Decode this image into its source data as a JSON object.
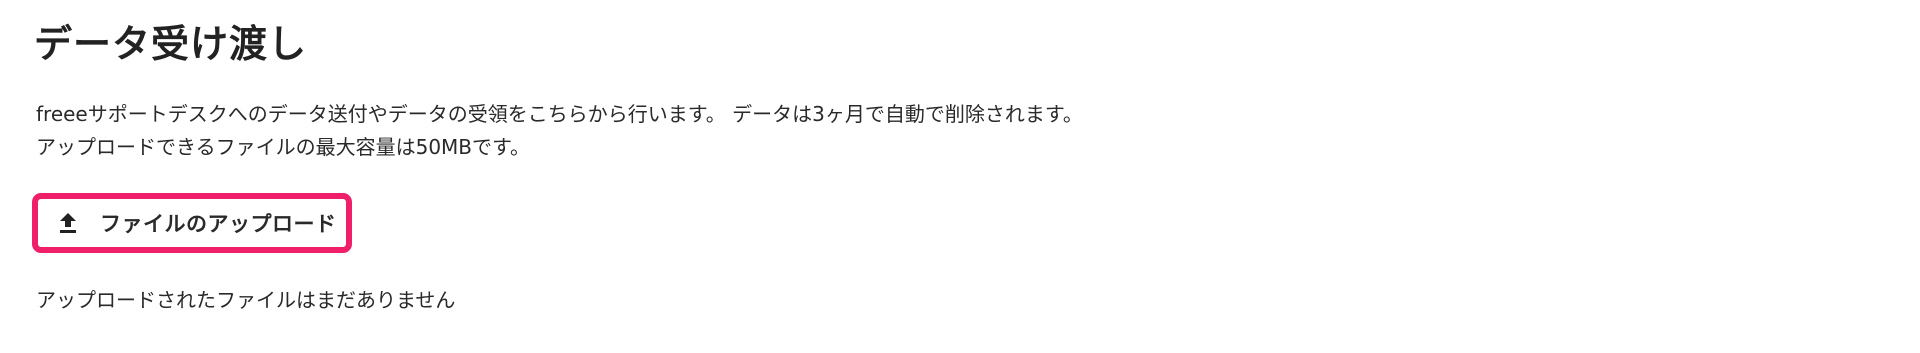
{
  "page": {
    "title": "データ受け渡し",
    "description_lines": [
      "freeeサポートデスクへのデータ送付やデータの受領をこちらから行います。 データは3ヶ月で自動で削除されます。",
      "アップロードできるファイルの最大容量は50MBです。"
    ]
  },
  "upload": {
    "label": "ファイルのアップロード",
    "icon": "upload-icon",
    "highlight_color": "#ef1f6a"
  },
  "files": {
    "empty_message": "アップロードされたファイルはまだありません"
  }
}
